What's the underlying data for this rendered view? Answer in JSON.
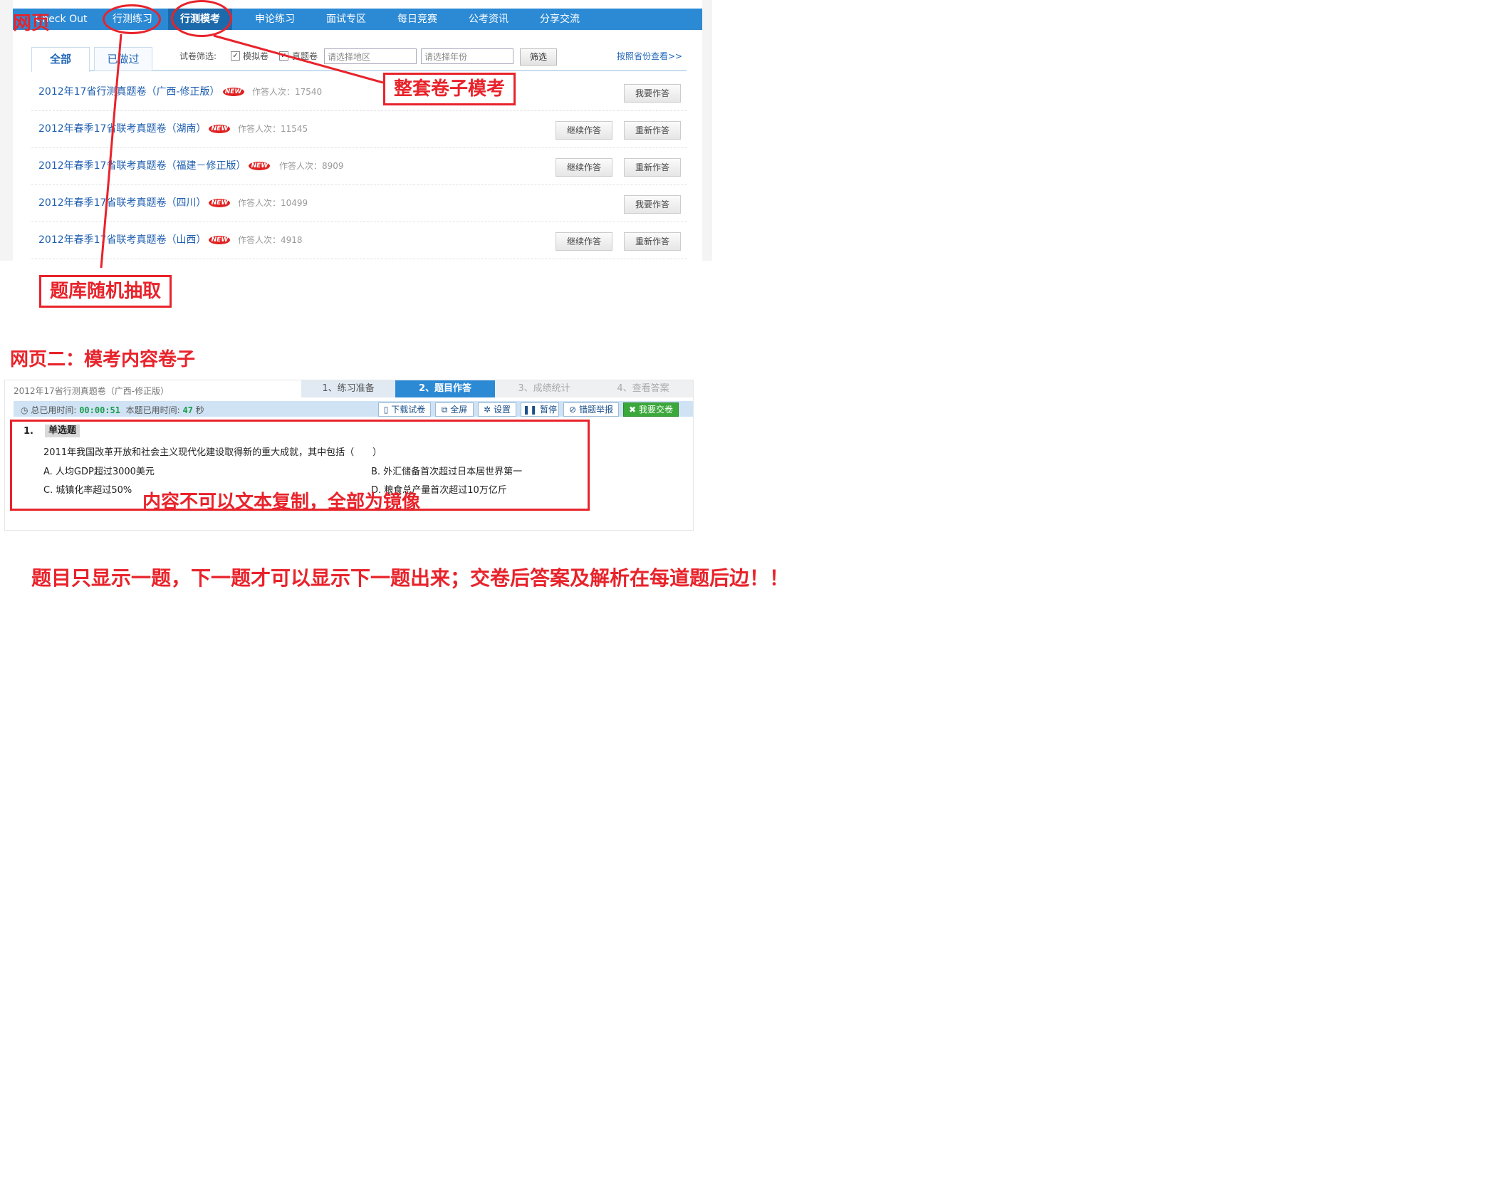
{
  "page1": {
    "label": "网页",
    "nav": [
      {
        "label": "Check Out",
        "active": false
      },
      {
        "label": "行测练习",
        "active": false
      },
      {
        "label": "行测模考",
        "active": true
      },
      {
        "label": "申论练习",
        "active": false
      },
      {
        "label": "面试专区",
        "active": false
      },
      {
        "label": "每日竞赛",
        "active": false
      },
      {
        "label": "公考资讯",
        "active": false
      },
      {
        "label": "分享交流",
        "active": false
      }
    ],
    "tabs": [
      {
        "label": "全部",
        "active": true
      },
      {
        "label": "已做过",
        "active": false
      }
    ],
    "filter": {
      "label": "试卷筛选:",
      "options": [
        "模拟卷",
        "真题卷"
      ],
      "region_placeholder": "请选择地区",
      "year_placeholder": "请选择年份",
      "button": "筛选",
      "province_link": "按照省份查看>>"
    },
    "new_badge": "NEW",
    "papers": [
      {
        "title": "2012年17省行测真题卷（广西-修正版）",
        "count": "作答人次：17540",
        "buttons": [
          "我要作答"
        ]
      },
      {
        "title": "2012年春季17省联考真题卷（湖南）",
        "count": "作答人次：11545",
        "buttons": [
          "继续作答",
          "重新作答"
        ]
      },
      {
        "title": "2012年春季17省联考真题卷（福建－修正版）",
        "count": "作答人次：8909",
        "buttons": [
          "继续作答",
          "重新作答"
        ]
      },
      {
        "title": "2012年春季17省联考真题卷（四川）",
        "count": "作答人次：10499",
        "buttons": [
          "我要作答"
        ]
      },
      {
        "title": "2012年春季17省联考真题卷（山西）",
        "count": "作答人次：4918",
        "buttons": [
          "继续作答",
          "重新作答"
        ]
      }
    ]
  },
  "annotations": {
    "whole_paper": "整套卷子模考",
    "random_bank": "题库随机抽取",
    "page2_heading": "网页二：模考内容卷子",
    "mirror_note": "内容不可以文本复制，全部为镜像",
    "bottom_note": "题目只显示一题，下一题才可以显示下一题出来；交卷后答案及解析在每道题后边！！"
  },
  "page2": {
    "paper_title": "2012年17省行测真题卷（广西-修正版）",
    "steps": [
      "1、练习准备",
      "2、题目作答",
      "3、成绩统计",
      "4、查看答案"
    ],
    "current_step": 2,
    "timer": {
      "total_label": "总已用时间:",
      "total_value": "00:00:51",
      "question_label": "本题已用时间:",
      "question_value": "47",
      "unit": "秒"
    },
    "toolbar": [
      "下载试卷",
      "全屏",
      "设置",
      "暂停",
      "错题举报",
      "我要交卷"
    ],
    "question": {
      "number": "1.",
      "type": "单选题",
      "stem": "2011年我国改革开放和社会主义现代化建设取得新的重大成就，其中包括（　　）",
      "options": [
        "A. 人均GDP超过3000美元",
        "B. 外汇储备首次超过日本居世界第一",
        "C. 城镇化率超过50%",
        "D. 粮食总产量首次超过10万亿斤"
      ]
    }
  }
}
